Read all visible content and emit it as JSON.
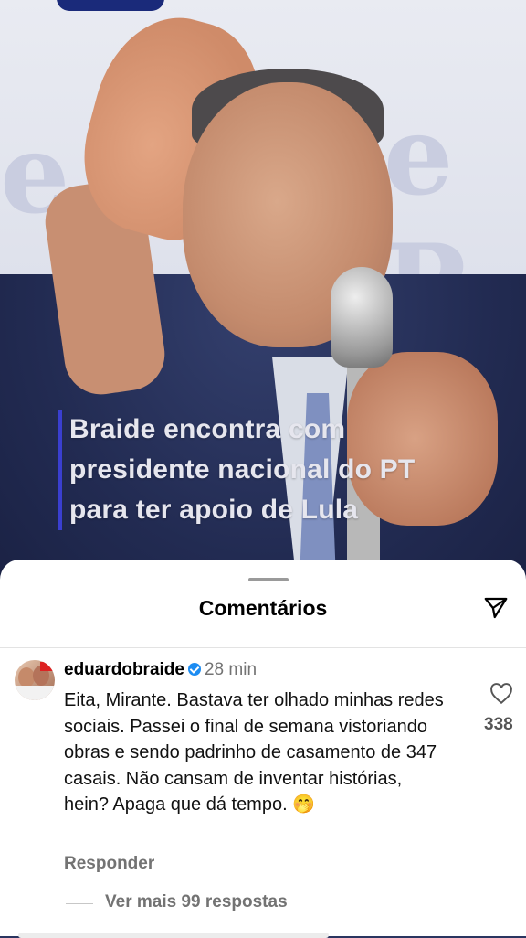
{
  "post": {
    "headline_lines": [
      "Braide encontra com",
      "presidente nacional do PT",
      "para ter apoio de Lula"
    ]
  },
  "comments_sheet": {
    "title": "Comentários",
    "comment": {
      "username": "eduardobraide",
      "time": "28 min",
      "text": "Eita, Mirante. Bastava ter olhado minhas redes sociais. Passei o final de semana vistoriando obras e sendo padrinho de casamento de 347 casais. Não cansam de inventar histórias, hein? Apaga que dá tempo. 🤭",
      "likes": "338",
      "reply_label": "Responder",
      "view_replies_label": "Ver mais 99 respostas"
    }
  },
  "icons": {
    "share": "send-icon",
    "like": "heart-icon",
    "verified": "verified-badge-icon"
  },
  "colors": {
    "verified": "#1c8cf2",
    "headline_bar": "#3a3fd0"
  }
}
